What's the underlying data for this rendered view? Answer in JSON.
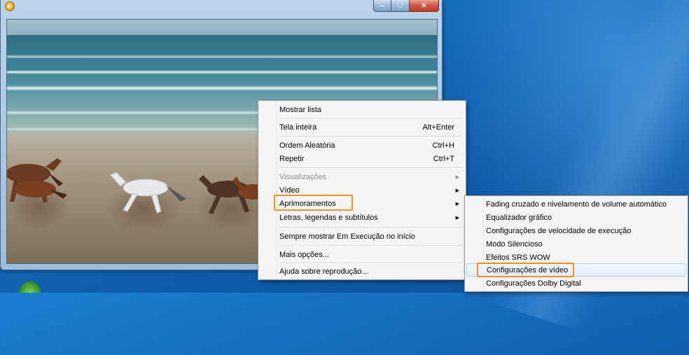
{
  "window": {
    "controls": {
      "minimize": "‒",
      "maximize": "□",
      "close": "✕"
    },
    "app_icon": "media-player-icon"
  },
  "context_menu": {
    "items": [
      {
        "label": "Mostrar lista",
        "shortcut": ""
      },
      {
        "label": "Tela inteira",
        "shortcut": "Alt+Enter"
      },
      {
        "label": "Ordem Aleatória",
        "shortcut": "Ctrl+H"
      },
      {
        "label": "Repetir",
        "shortcut": "Ctrl+T"
      },
      {
        "label": "Visualizações",
        "shortcut": "",
        "disabled": true,
        "submenu": true
      },
      {
        "label": "Vídeo",
        "shortcut": "",
        "submenu": true
      },
      {
        "label": "Aprimoramentos",
        "shortcut": "",
        "submenu": true,
        "highlighted": true
      },
      {
        "label": "Letras, legendas e subtítulos",
        "shortcut": "",
        "submenu": true
      },
      {
        "label": "Sempre mostrar Em Execução no início",
        "shortcut": ""
      },
      {
        "label": "Mais opções...",
        "shortcut": ""
      },
      {
        "label": "Ajuda sobre reprodução...",
        "shortcut": ""
      }
    ]
  },
  "submenu": {
    "items": [
      {
        "label": "Fading cruzado e nivelamento de volume automático"
      },
      {
        "label": "Equalizador gráfico"
      },
      {
        "label": "Configurações de velocidade de execução"
      },
      {
        "label": "Modo Silencioso"
      },
      {
        "label": "Efeitos SRS WOW"
      },
      {
        "label": "Configurações de vídeo",
        "hover": true,
        "highlighted": true
      },
      {
        "label": "Configurações Dolby Digital"
      }
    ]
  },
  "colors": {
    "highlight_box": "#f0901e",
    "menu_bg": "#f4f4f4",
    "desktop": "#1468b8"
  },
  "submenu_arrow": "▶"
}
